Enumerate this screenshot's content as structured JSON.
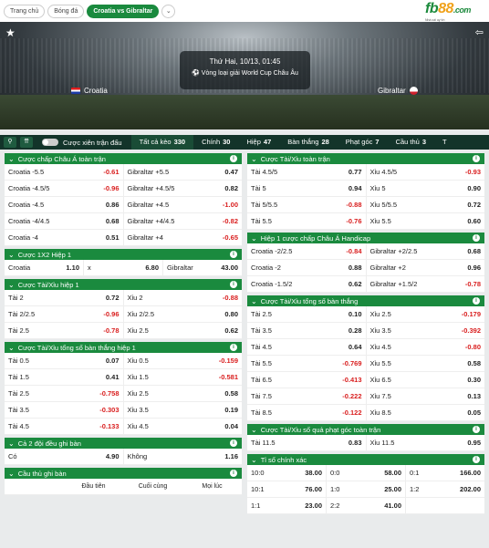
{
  "breadcrumbs": [
    "Trang chủ",
    "Bóng đá",
    "Croatia vs Gibraltar"
  ],
  "logo": {
    "text_main": "fb",
    "text_accent": "88",
    "text_suffix": ".com",
    "tagline": "Nhà cái uy tín"
  },
  "match": {
    "datetime": "Thứ Hai, 10/13, 01:45",
    "competition": "Vòng loại giải World Cup Châu Âu",
    "home": "Croatia",
    "away": "Gibraltar"
  },
  "filter": {
    "toggle_label": "Cược xiên trận đấu"
  },
  "tabs": [
    {
      "label": "Tất cả kèo",
      "count": "330"
    },
    {
      "label": "Chính",
      "count": "30"
    },
    {
      "label": "Hiệp",
      "count": "47"
    },
    {
      "label": "Bàn thắng",
      "count": "28"
    },
    {
      "label": "Phạt góc",
      "count": "7"
    },
    {
      "label": "Cầu thủ",
      "count": "3"
    },
    {
      "label": "T",
      "count": ""
    }
  ],
  "left_panels": [
    {
      "title": "Cược chấp Châu Á toàn trận",
      "cols": 2,
      "rows": [
        [
          [
            "Croatia -5.5",
            "-0.61"
          ],
          [
            "Gibraltar +5.5",
            "0.47"
          ]
        ],
        [
          [
            "Croatia -4.5/5",
            "-0.96"
          ],
          [
            "Gibraltar +4.5/5",
            "0.82"
          ]
        ],
        [
          [
            "Croatia -4.5",
            "0.86"
          ],
          [
            "Gibraltar +4.5",
            "-1.00"
          ]
        ],
        [
          [
            "Croatia -4/4.5",
            "0.68"
          ],
          [
            "Gibraltar +4/4.5",
            "-0.82"
          ]
        ],
        [
          [
            "Croatia -4",
            "0.51"
          ],
          [
            "Gibraltar +4",
            "-0.65"
          ]
        ]
      ]
    },
    {
      "title": "Cược 1X2 Hiệp 1",
      "cols": 3,
      "rows": [
        [
          [
            "Croatia",
            "1.10"
          ],
          [
            "x",
            "6.80"
          ],
          [
            "Gibraltar",
            "43.00"
          ]
        ]
      ]
    },
    {
      "title": "Cược Tài/Xỉu hiệp 1",
      "cols": 2,
      "rows": [
        [
          [
            "Tài 2",
            "0.72"
          ],
          [
            "Xỉu 2",
            "-0.88"
          ]
        ],
        [
          [
            "Tài 2/2.5",
            "-0.96"
          ],
          [
            "Xỉu 2/2.5",
            "0.80"
          ]
        ],
        [
          [
            "Tài 2.5",
            "-0.78"
          ],
          [
            "Xỉu 2.5",
            "0.62"
          ]
        ]
      ]
    },
    {
      "title": "Cược Tài/Xỉu tổng số bàn thắng hiệp 1",
      "cols": 2,
      "rows": [
        [
          [
            "Tài 0.5",
            "0.07"
          ],
          [
            "Xỉu 0.5",
            "-0.159"
          ]
        ],
        [
          [
            "Tài 1.5",
            "0.41"
          ],
          [
            "Xỉu 1.5",
            "-0.581"
          ]
        ],
        [
          [
            "Tài 2.5",
            "-0.758"
          ],
          [
            "Xỉu 2.5",
            "0.58"
          ]
        ],
        [
          [
            "Tài 3.5",
            "-0.303"
          ],
          [
            "Xỉu 3.5",
            "0.19"
          ]
        ],
        [
          [
            "Tài 4.5",
            "-0.133"
          ],
          [
            "Xỉu 4.5",
            "0.04"
          ]
        ]
      ]
    },
    {
      "title": "Cả 2 đội đều ghi bàn",
      "cols": 2,
      "rows": [
        [
          [
            "Có",
            "4.90"
          ],
          [
            "Không",
            "1.16"
          ]
        ]
      ]
    },
    {
      "title": "Cầu thủ ghi bàn",
      "cols": 0,
      "headers": [
        "Đầu tiên",
        "Cuối cùng",
        "Mọi lúc"
      ],
      "rows": []
    }
  ],
  "right_panels": [
    {
      "title": "Cược Tài/Xỉu toàn trận",
      "cols": 2,
      "rows": [
        [
          [
            "Tài 4.5/5",
            "0.77"
          ],
          [
            "Xỉu 4.5/5",
            "-0.93"
          ]
        ],
        [
          [
            "Tài 5",
            "0.94"
          ],
          [
            "Xỉu 5",
            "0.90"
          ]
        ],
        [
          [
            "Tài 5/5.5",
            "-0.88"
          ],
          [
            "Xỉu 5/5.5",
            "0.72"
          ]
        ],
        [
          [
            "Tài 5.5",
            "-0.76"
          ],
          [
            "Xỉu 5.5",
            "0.60"
          ]
        ]
      ]
    },
    {
      "title": "Hiệp 1 cược chấp Châu Á Handicap",
      "cols": 2,
      "rows": [
        [
          [
            "Croatia -2/2.5",
            "-0.84"
          ],
          [
            "Gibraltar +2/2.5",
            "0.68"
          ]
        ],
        [
          [
            "Croatia -2",
            "0.88"
          ],
          [
            "Gibraltar +2",
            "0.96"
          ]
        ],
        [
          [
            "Croatia -1.5/2",
            "0.62"
          ],
          [
            "Gibraltar +1.5/2",
            "-0.78"
          ]
        ]
      ]
    },
    {
      "title": "Cược Tài/Xỉu tổng số bàn thắng",
      "cols": 2,
      "rows": [
        [
          [
            "Tài 2.5",
            "0.10"
          ],
          [
            "Xỉu 2.5",
            "-0.179"
          ]
        ],
        [
          [
            "Tài 3.5",
            "0.28"
          ],
          [
            "Xỉu 3.5",
            "-0.392"
          ]
        ],
        [
          [
            "Tài 4.5",
            "0.64"
          ],
          [
            "Xỉu 4.5",
            "-0.80"
          ]
        ],
        [
          [
            "Tài 5.5",
            "-0.769"
          ],
          [
            "Xỉu 5.5",
            "0.58"
          ]
        ],
        [
          [
            "Tài 6.5",
            "-0.413"
          ],
          [
            "Xỉu 6.5",
            "0.30"
          ]
        ],
        [
          [
            "Tài 7.5",
            "-0.222"
          ],
          [
            "Xỉu 7.5",
            "0.13"
          ]
        ],
        [
          [
            "Tài 8.5",
            "-0.122"
          ],
          [
            "Xỉu 8.5",
            "0.05"
          ]
        ]
      ]
    },
    {
      "title": "Cược Tài/Xỉu số quả phạt góc toàn trận",
      "cols": 2,
      "rows": [
        [
          [
            "Tài 11.5",
            "0.83"
          ],
          [
            "Xỉu 11.5",
            "0.95"
          ]
        ]
      ]
    },
    {
      "title": "Tỉ số chính xác",
      "cols": 3,
      "rows": [
        [
          [
            "10:0",
            "38.00"
          ],
          [
            "0:0",
            "58.00"
          ],
          [
            "0:1",
            "166.00"
          ]
        ],
        [
          [
            "10:1",
            "76.00"
          ],
          [
            "1:0",
            "25.00"
          ],
          [
            "1:2",
            "202.00"
          ]
        ],
        [
          [
            "1:1",
            "23.00"
          ],
          [
            "2:2",
            "41.00"
          ],
          [
            "",
            ""
          ]
        ]
      ]
    }
  ]
}
